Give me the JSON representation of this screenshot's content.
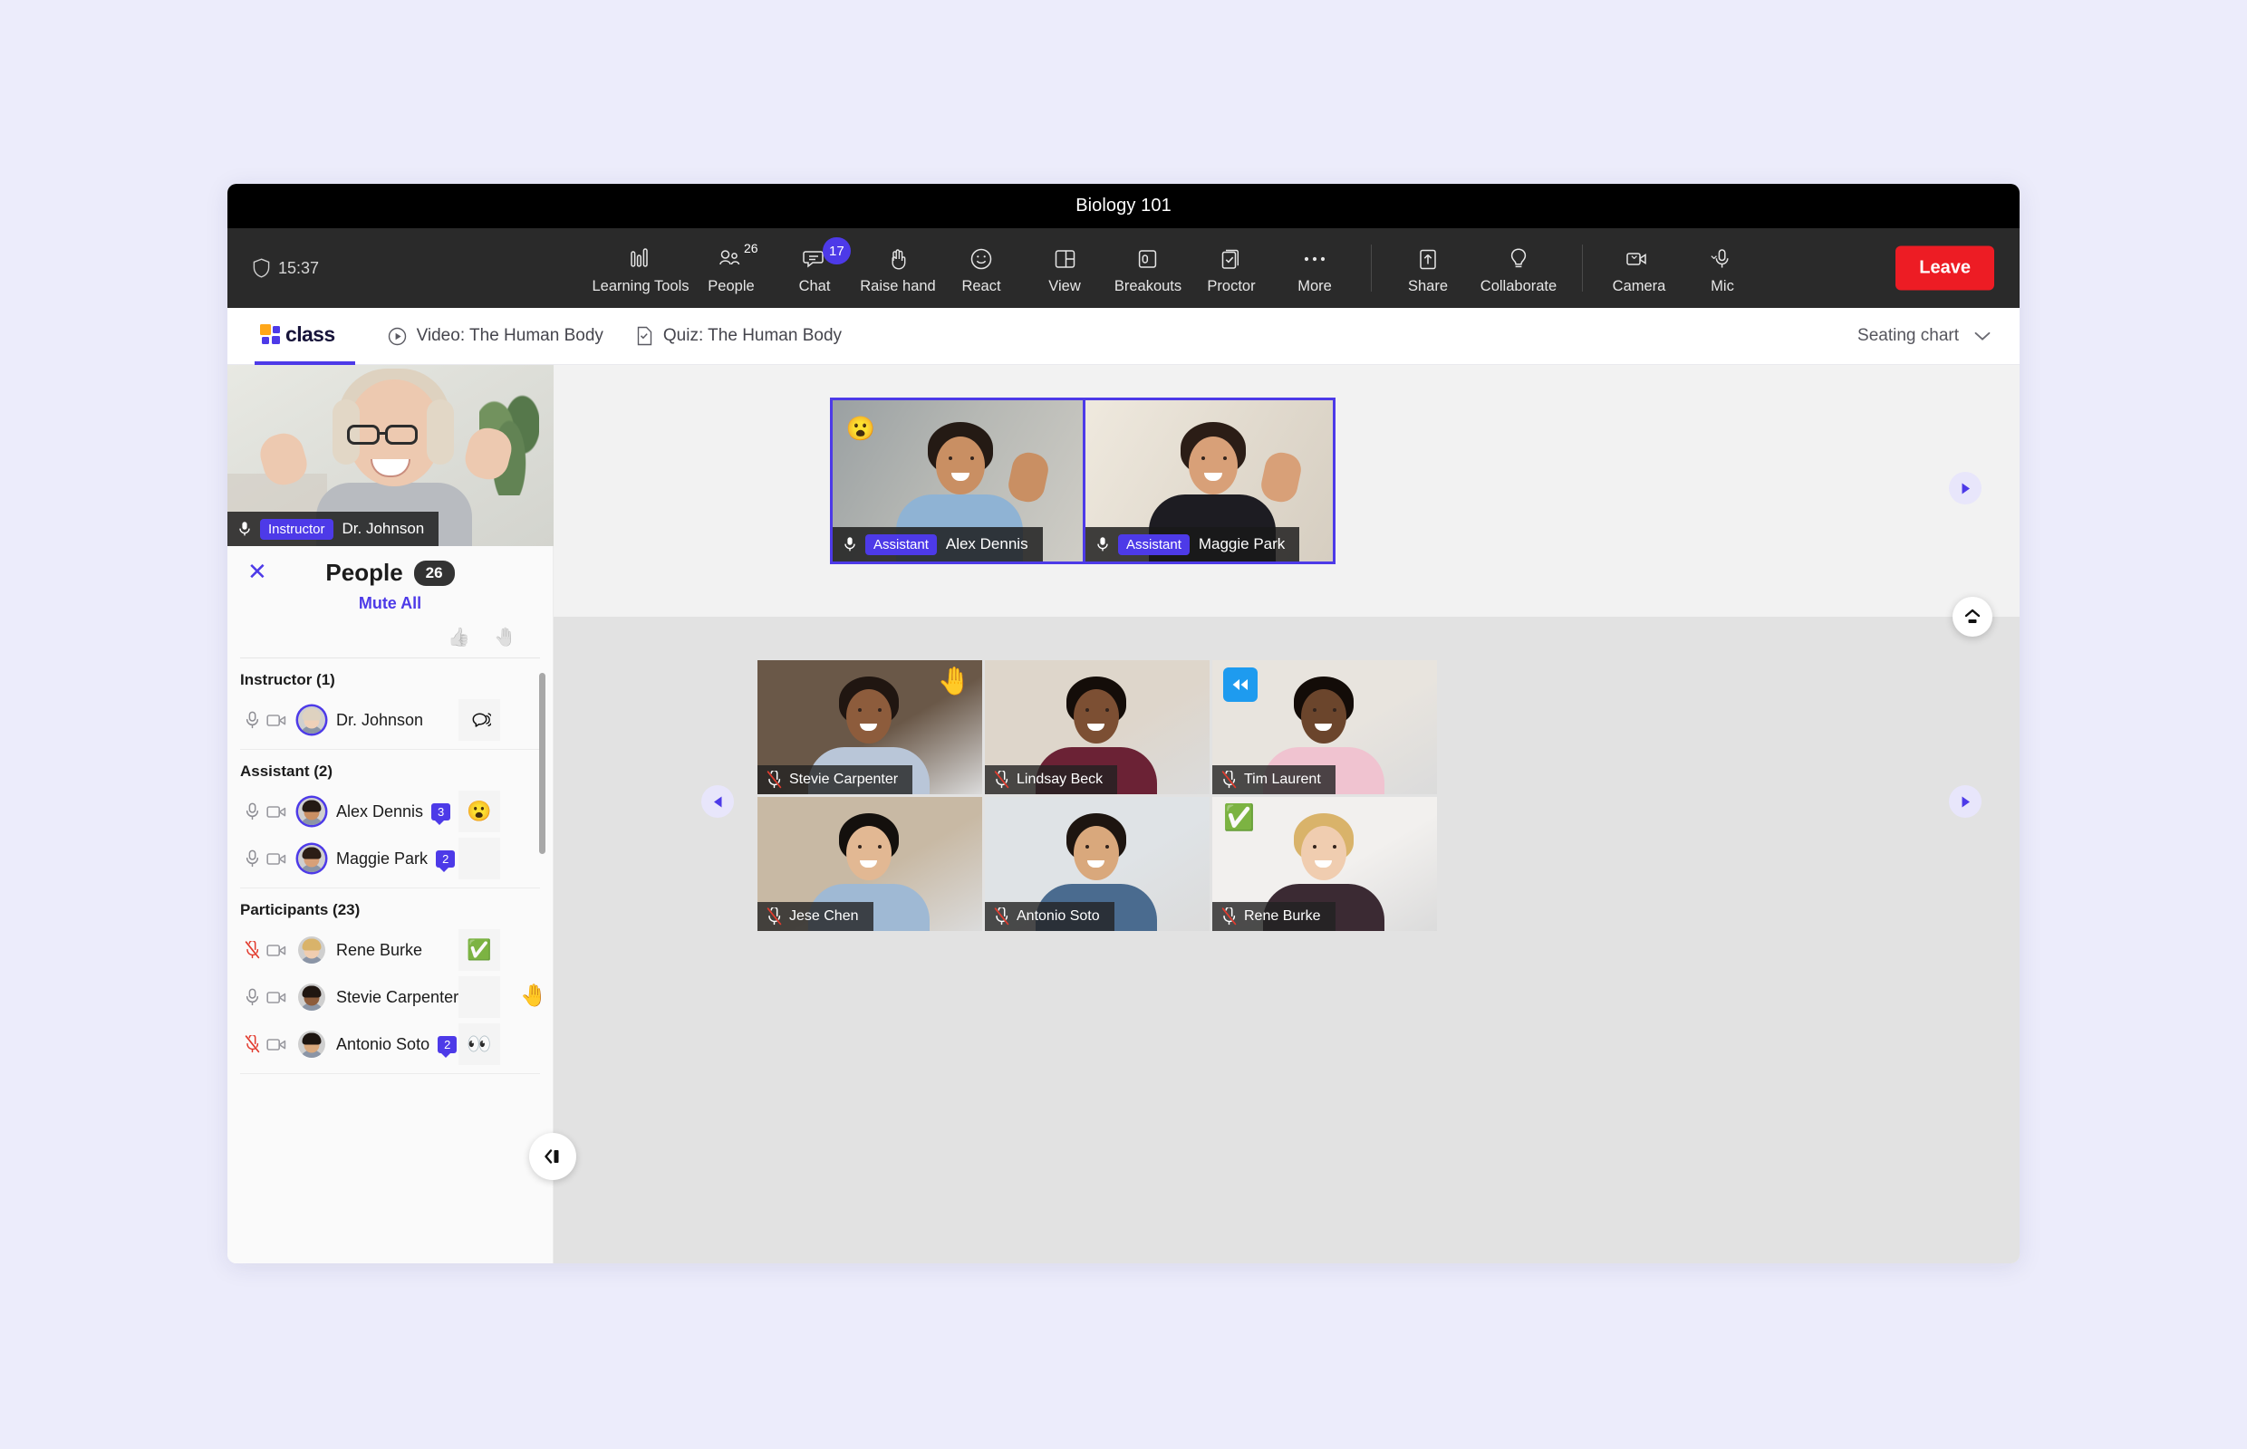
{
  "window": {
    "title": "Biology 101"
  },
  "toolbar": {
    "timer": "15:37",
    "shield_icon": "shield-icon",
    "items": [
      {
        "label": "Learning Tools",
        "icon": "learning-tools-icon",
        "badge": null,
        "badge_style": null
      },
      {
        "label": "People",
        "icon": "people-icon",
        "badge": "26",
        "badge_style": "sup"
      },
      {
        "label": "Chat",
        "icon": "chat-icon",
        "badge": "17",
        "badge_style": "pill"
      },
      {
        "label": "Raise hand",
        "icon": "raise-hand-icon",
        "badge": null,
        "badge_style": null
      },
      {
        "label": "React",
        "icon": "react-smiley-icon",
        "badge": null,
        "badge_style": null
      },
      {
        "label": "View",
        "icon": "view-layout-icon",
        "badge": null,
        "badge_style": null
      },
      {
        "label": "Breakouts",
        "icon": "breakouts-icon",
        "badge": null,
        "badge_style": null
      },
      {
        "label": "Proctor",
        "icon": "proctor-icon",
        "badge": null,
        "badge_style": null
      },
      {
        "label": "More",
        "icon": "more-ellipsis-icon",
        "badge": null,
        "badge_style": null
      },
      {
        "label": "Share",
        "icon": "share-upload-icon",
        "badge": null,
        "badge_style": null
      },
      {
        "label": "Collaborate",
        "icon": "collaborate-bulb-icon",
        "badge": null,
        "badge_style": null
      },
      {
        "label": "Camera",
        "icon": "camera-icon",
        "badge": null,
        "badge_style": null,
        "chevron": true
      },
      {
        "label": "Mic",
        "icon": "mic-icon",
        "badge": null,
        "badge_style": null,
        "chevron": true
      }
    ],
    "leave_label": "Leave",
    "leave_color": "#ed1c24"
  },
  "subnav": {
    "brand": "class",
    "tabs": [
      {
        "label": "Video: The Human Body",
        "icon": "play-circle-icon"
      },
      {
        "label": "Quiz: The Human Body",
        "icon": "quiz-doc-icon"
      }
    ],
    "view_selector": {
      "label": "Seating chart",
      "icon": "chevron-down-icon"
    }
  },
  "instructor_video": {
    "name": "Dr. Johnson",
    "role": "Instructor",
    "mic_icon": "mic-on-icon"
  },
  "featured": [
    {
      "name": "Alex Dennis",
      "role": "Assistant",
      "mic_icon": "mic-on-icon",
      "reaction": "😮"
    },
    {
      "name": "Maggie Park",
      "role": "Assistant",
      "mic_icon": "mic-on-icon",
      "reaction": null
    }
  ],
  "people_panel": {
    "close_icon": "close-icon",
    "title": "People",
    "count": "26",
    "mute_all": "Mute All",
    "column_icons": [
      {
        "icon": "thumbs-up-icon",
        "glyph": "👍"
      },
      {
        "icon": "raised-hand-icon",
        "glyph": "🤚"
      }
    ],
    "groups": [
      {
        "heading": "Instructor (1)",
        "rows": [
          {
            "name": "Dr. Johnson",
            "mic": "on",
            "cam": "on",
            "ring": true,
            "chat": null,
            "reaction": "speaking",
            "hand": false,
            "skin": "#efd0b8",
            "hair": "#ded2c0"
          }
        ]
      },
      {
        "heading": "Assistant (2)",
        "rows": [
          {
            "name": "Alex Dennis",
            "mic": "on",
            "cam": "on",
            "ring": true,
            "chat": "3",
            "reaction": "😮",
            "hand": false,
            "skin": "#c98f63",
            "hair": "#241a14"
          },
          {
            "name": "Maggie Park",
            "mic": "on",
            "cam": "on",
            "ring": true,
            "chat": "2",
            "reaction": null,
            "hand": false,
            "skin": "#d8a078",
            "hair": "#2b1d16"
          }
        ]
      },
      {
        "heading": "Participants (23)",
        "rows": [
          {
            "name": "Rene Burke",
            "mic": "off",
            "cam": "on",
            "ring": false,
            "chat": null,
            "reaction": "✅",
            "hand": false,
            "skin": "#f0cdb0",
            "hair": "#d9b36a"
          },
          {
            "name": "Stevie Carpenter",
            "mic": "on",
            "cam": "on",
            "ring": false,
            "chat": null,
            "reaction": null,
            "hand": true,
            "skin": "#8d5c3c",
            "hair": "#201611"
          },
          {
            "name": "Antonio Soto",
            "mic": "off",
            "cam": "on",
            "ring": false,
            "chat": "2",
            "reaction": "👀",
            "hand": false,
            "skin": "#d9a87c",
            "hair": "#1d1510"
          }
        ]
      }
    ],
    "collapse_icon": "collapse-panel-icon"
  },
  "gallery": {
    "prev_icon": "arrow-left-icon",
    "next_icon": "arrow-right-icon",
    "stage_next_icon": "arrow-right-icon",
    "stage_expand_icon": "expand-up-icon",
    "tiles": [
      {
        "name": "Stevie Carpenter",
        "mic": "off",
        "reaction": "🤚",
        "reaction_kind": "emoji",
        "bg": "#6a5848",
        "skin": "#8d5c3c",
        "hair": "#201611",
        "shirt": "#b9c6d8"
      },
      {
        "name": "Lindsay Beck",
        "mic": "off",
        "reaction": null,
        "reaction_kind": null,
        "bg": "#ded6cb",
        "skin": "#7c4f33",
        "hair": "#140d09",
        "shirt": "#6b2235"
      },
      {
        "name": "Tim Laurent",
        "mic": "off",
        "reaction": "rewind",
        "reaction_kind": "badge",
        "bg": "#e8e4de",
        "skin": "#6b452c",
        "hair": "#130c08",
        "shirt": "#f0c3d0"
      },
      {
        "name": "Jese Chen",
        "mic": "off",
        "reaction": null,
        "reaction_kind": null,
        "bg": "#c8b9a4",
        "skin": "#e2b893",
        "hair": "#14100d",
        "shirt": "#9fb9d4"
      },
      {
        "name": "Antonio Soto",
        "mic": "off",
        "reaction": null,
        "reaction_kind": null,
        "bg": "#dfe3e6",
        "skin": "#d9a87c",
        "hair": "#1d1510",
        "shirt": "#4a6b8f"
      },
      {
        "name": "Rene Burke",
        "mic": "off",
        "reaction": "✅",
        "reaction_kind": "emoji",
        "bg": "#f2f0ee",
        "skin": "#f0cdb0",
        "hair": "#d9b36a",
        "shirt": "#3b2a33"
      }
    ]
  },
  "colors": {
    "accent": "#4d3ae8",
    "danger": "#ed1c24",
    "toolbar_bg": "#2a2a2a",
    "title_bg": "#000000",
    "page_bg": "#ececeb"
  }
}
